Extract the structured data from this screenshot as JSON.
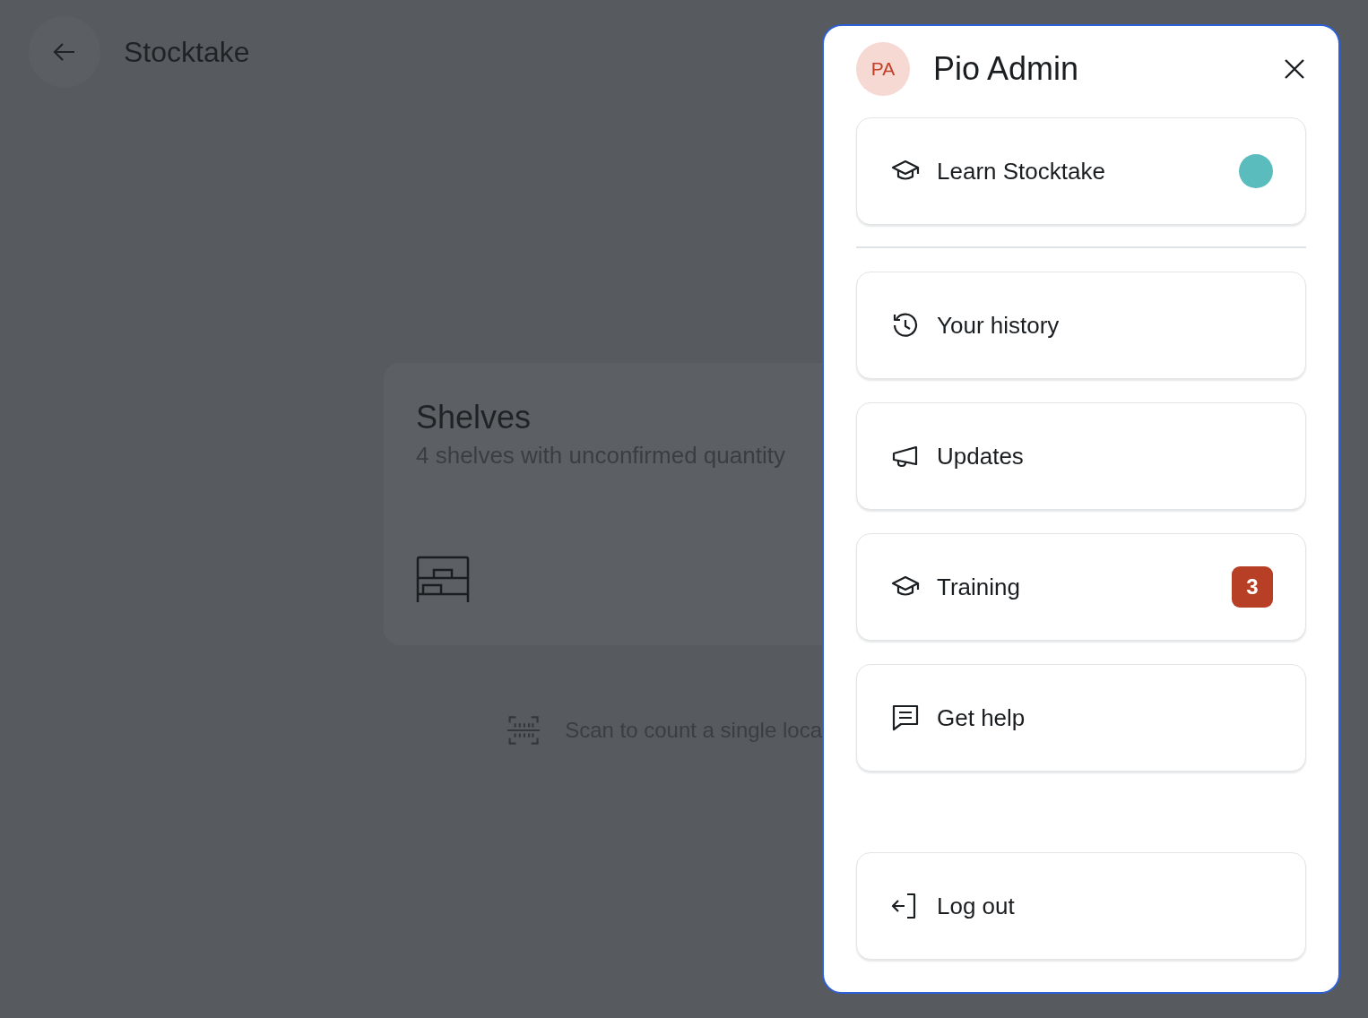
{
  "header": {
    "title": "Stocktake"
  },
  "shelves_card": {
    "title": "Shelves",
    "subtitle": "4 shelves with unconfirmed quantity"
  },
  "scan_hint": "Scan to count a single loca",
  "menu": {
    "avatar_initials": "PA",
    "user_name": "Pio Admin",
    "top": [
      {
        "kind": "learn",
        "label": "Learn Stocktake",
        "new_dot": true
      }
    ],
    "main": [
      {
        "kind": "history",
        "label": "Your history",
        "new_dot": false
      },
      {
        "kind": "updates",
        "label": "Updates",
        "new_dot": false
      },
      {
        "kind": "training",
        "label": "Training",
        "new_dot": false,
        "badge": "3"
      },
      {
        "kind": "help",
        "label": "Get help",
        "new_dot": false
      }
    ],
    "footer": [
      {
        "kind": "logout",
        "label": "Log out",
        "new_dot": false
      }
    ]
  }
}
